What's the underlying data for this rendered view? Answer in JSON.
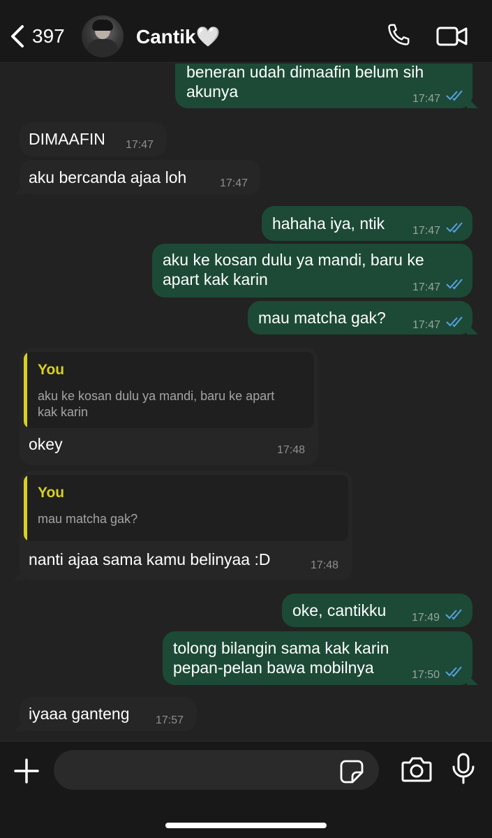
{
  "header": {
    "back_count": "397",
    "contact_name": "Cantik🤍",
    "icons": [
      "chevron-left-icon",
      "phone-icon",
      "video-camera-icon"
    ]
  },
  "messages": [
    {
      "dir": "out",
      "lines": [
        "beneran udah dimaafin belum sih",
        "akunya"
      ],
      "time": "17:47",
      "status": "read"
    },
    {
      "dir": "in",
      "lines": [
        "DIMAAFIN"
      ],
      "time": "17:47"
    },
    {
      "dir": "in",
      "lines": [
        "aku bercanda ajaa loh"
      ],
      "time": "17:47"
    },
    {
      "dir": "out",
      "lines": [
        "hahaha iya, ntik"
      ],
      "time": "17:47",
      "status": "read"
    },
    {
      "dir": "out",
      "lines": [
        "aku ke kosan dulu ya mandi, baru ke",
        "apart kak karin"
      ],
      "time": "17:47",
      "status": "read"
    },
    {
      "dir": "out",
      "lines": [
        "mau matcha gak?"
      ],
      "time": "17:47",
      "status": "read"
    },
    {
      "dir": "in",
      "reply": {
        "name": "You",
        "lines": [
          "aku ke kosan dulu ya mandi, baru ke apart",
          "kak karin"
        ]
      },
      "lines": [
        "okey"
      ],
      "time": "17:48"
    },
    {
      "dir": "in",
      "reply": {
        "name": "You",
        "lines": [
          "mau matcha gak?"
        ]
      },
      "lines": [
        "nanti ajaa sama kamu belinyaa :D"
      ],
      "time": "17:48"
    },
    {
      "dir": "out",
      "lines": [
        "oke, cantikku"
      ],
      "time": "17:49",
      "status": "read"
    },
    {
      "dir": "out",
      "lines": [
        "tolong bilangin sama kak karin",
        "pepan-pelan bawa mobilnya"
      ],
      "time": "17:50",
      "status": "read"
    },
    {
      "dir": "in",
      "lines": [
        "iyaaa ganteng"
      ],
      "time": "17:57"
    }
  ],
  "input": {
    "value": "",
    "placeholder": ""
  },
  "bottom_icons": [
    "plus-icon",
    "sticker-icon",
    "camera-icon",
    "microphone-icon"
  ],
  "colors": {
    "background": "#222222",
    "incoming_bubble": "#262626",
    "outgoing_bubble": "#1c4a36",
    "read_ticks": "#5aa0e6",
    "reply_accent": "#d9d11e"
  }
}
